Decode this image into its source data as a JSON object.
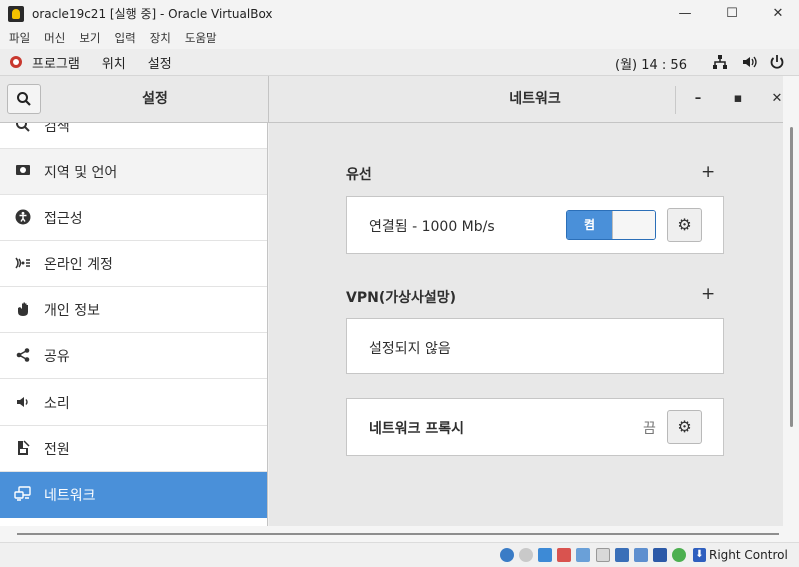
{
  "vbox": {
    "window_title": "oracle19c21 [실행 중] - Oracle VirtualBox",
    "minimize": "—",
    "maximize": "☐",
    "close": "✕",
    "menu": [
      "파일",
      "머신",
      "보기",
      "입력",
      "장치",
      "도움말"
    ],
    "host_key": "Right Control"
  },
  "gnome": {
    "menus": [
      "프로그램",
      "위치",
      "설정"
    ],
    "clock": "(월) 14 : 56",
    "tray_icons": [
      "network-icon",
      "volume-icon",
      "power-icon"
    ]
  },
  "settings": {
    "sidebar_title": "설정",
    "panel_title": "네트워크",
    "window_buttons": {
      "minimize": "–",
      "maximize": "▪",
      "close": "✕"
    },
    "sidebar": [
      {
        "icon": "search-icon",
        "label": "검색",
        "state": "partial"
      },
      {
        "icon": "region-language-icon",
        "label": "지역 및 언어",
        "state": "hover"
      },
      {
        "icon": "accessibility-icon",
        "label": "접근성",
        "state": "normal"
      },
      {
        "icon": "online-accounts-icon",
        "label": "온라인 계정",
        "state": "normal"
      },
      {
        "icon": "privacy-hand-icon",
        "label": "개인 정보",
        "state": "normal"
      },
      {
        "icon": "share-icon",
        "label": "공유",
        "state": "normal"
      },
      {
        "icon": "sound-icon",
        "label": "소리",
        "state": "normal"
      },
      {
        "icon": "power-plug-icon",
        "label": "전원",
        "state": "normal"
      },
      {
        "icon": "network-icon",
        "label": "네트워크",
        "state": "selected"
      }
    ],
    "wired": {
      "title": "유선",
      "add": "+",
      "status": "연결됨 - 1000 Mb/s",
      "toggle_label": "켬",
      "toggle_on": true
    },
    "vpn": {
      "title": "VPN(가상사설망)",
      "add": "+",
      "status": "설정되지 않음"
    },
    "proxy": {
      "title": "네트워크 프록시",
      "status": "끔"
    }
  },
  "colors": {
    "accent": "#4a90d9",
    "panel_bg": "#e8e8e8",
    "card_bg": "#ffffff"
  }
}
